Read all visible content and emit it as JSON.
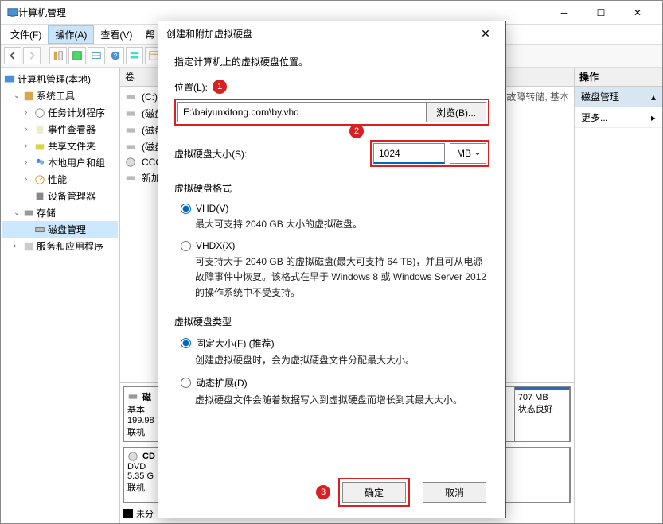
{
  "main": {
    "title": "计算机管理",
    "menu": {
      "file": "文件(F)",
      "action": "操作(A)",
      "view": "查看(V)",
      "help": "帮"
    },
    "tree": {
      "root": "计算机管理(本地)",
      "systools": "系统工具",
      "task": "任务计划程序",
      "event": "事件查看器",
      "shared": "共享文件夹",
      "users": "本地用户和组",
      "perf": "性能",
      "devmgr": "设备管理器",
      "storage": "存储",
      "diskmgmt": "磁盘管理",
      "services": "服务和应用程序"
    },
    "mid": {
      "header": "卷",
      "vols": [
        "(C:)",
        "(磁盘",
        "(磁盘",
        "(磁盘",
        "CCC(",
        "新加"
      ],
      "volsuffix": ", 故障转储, 基本",
      "disk0": {
        "name": "磁",
        "type": "基本",
        "size": "199.98",
        "status": "联机"
      },
      "disk0_part": {
        "size": "707 MB",
        "status": "状态良好"
      },
      "cd": {
        "name": "CD",
        "type": "DVD",
        "size": "5.35 G",
        "status": "联机"
      },
      "unalloc": "未分"
    },
    "right": {
      "header": "操作",
      "row1": "磁盘管理",
      "row2": "更多..."
    }
  },
  "dialog": {
    "title": "创建和附加虚拟硬盘",
    "intro": "指定计算机上的虚拟硬盘位置。",
    "location_label": "位置(L):",
    "location_value": "E:\\baiyunxitong.com\\by.vhd",
    "browse": "浏览(B)...",
    "size_label": "虚拟硬盘大小(S):",
    "size_value": "1024",
    "size_unit": "MB",
    "format": {
      "title": "虚拟硬盘格式",
      "vhd": "VHD(V)",
      "vhd_desc": "最大可支持 2040 GB 大小的虚拟磁盘。",
      "vhdx": "VHDX(X)",
      "vhdx_desc": "可支持大于 2040 GB 的虚拟磁盘(最大可支持 64 TB)，并且可从电源故障事件中恢复。该格式在早于 Windows 8 或 Windows Server 2012 的操作系统中不受支持。"
    },
    "type": {
      "title": "虚拟硬盘类型",
      "fixed": "固定大小(F) (推荐)",
      "fixed_desc": "创建虚拟硬盘时，会为虚拟硬盘文件分配最大大小。",
      "dynamic": "动态扩展(D)",
      "dynamic_desc": "虚拟硬盘文件会随着数据写入到虚拟硬盘而增长到其最大大小。"
    },
    "ok": "确定",
    "cancel": "取消",
    "badges": {
      "b1": "1",
      "b2": "2",
      "b3": "3"
    }
  }
}
